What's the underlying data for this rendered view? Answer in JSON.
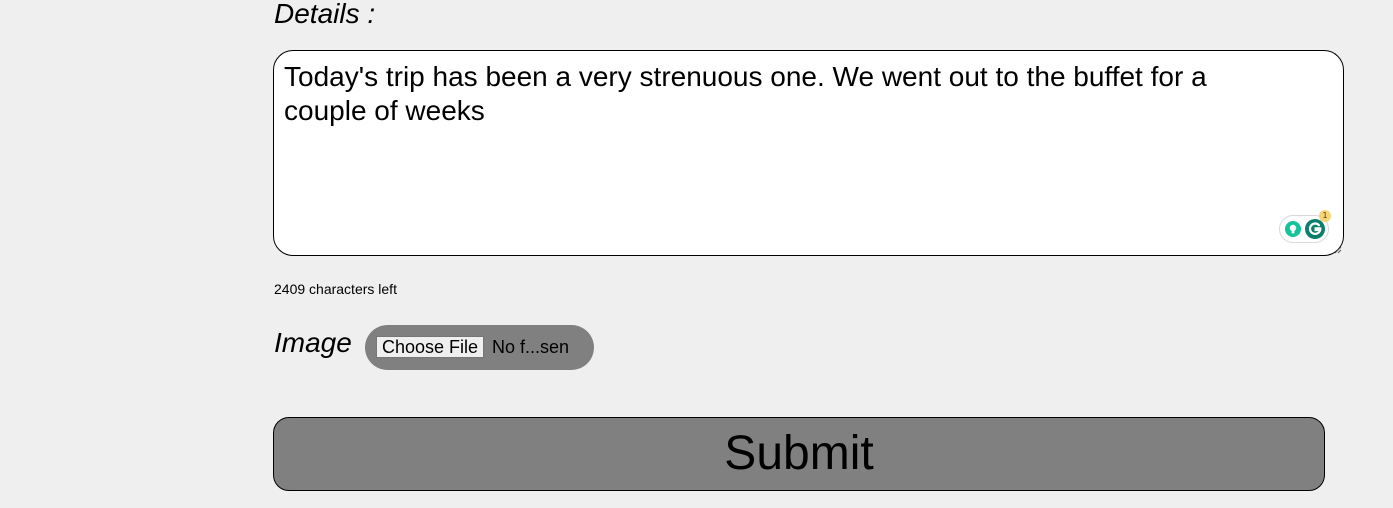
{
  "form": {
    "details_label": "Details :",
    "details_text": "Today's trip has been a very strenuous one. We went out to the buffet for a couple of weeks",
    "grammar_badge_count": "1",
    "chars_left": "2409 characters left",
    "image_label": "Image",
    "choose_file_label": "Choose File",
    "file_status": "No f...sen",
    "submit_label": "Submit"
  },
  "colors": {
    "page_background": "#efefef",
    "button_gray": "#808080",
    "grammarly_green": "#15c39a",
    "grammarly_dark": "#0b7f6a"
  },
  "icons": [
    "bulb-icon",
    "grammarly-icon",
    "resize-handle-icon"
  ]
}
